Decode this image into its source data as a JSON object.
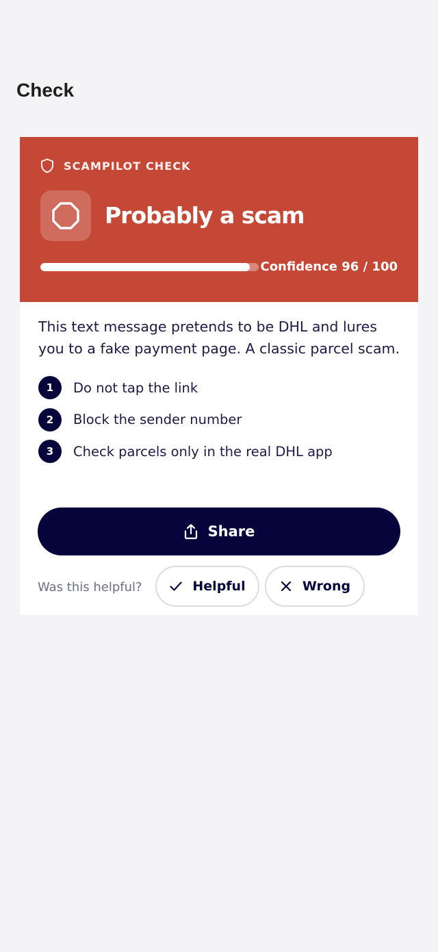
{
  "page": {
    "title": "Check"
  },
  "result_card": {
    "eyebrow": "SCAMPILOT CHECK",
    "eyebrow_icon": "shield-icon",
    "verdict_icon": "stop-octagon-icon",
    "verdict": "Probably a scam",
    "confidence_text": "Confidence 96 / 100",
    "confidence_value": 96,
    "confidence_max": 100,
    "summary": "This text message pretends to be DHL and lures you to a fake payment page. A classic parcel scam.",
    "steps": [
      {
        "number": "1",
        "text": "Do not tap the link"
      },
      {
        "number": "2",
        "text": "Block the sender number"
      },
      {
        "number": "3",
        "text": "Check parcels only in the real DHL app"
      }
    ],
    "share_label": "Share",
    "share_icon": "share-upload-icon",
    "feedback_prompt": "Was this helpful?",
    "helpful_label": "Helpful",
    "helpful_icon": "check-icon",
    "wrong_label": "Wrong",
    "wrong_icon": "close-icon"
  },
  "colors": {
    "page_background": "#f4f4f6",
    "header_red": "#c54836",
    "navy": "#06043b",
    "body_text": "#1b1a45",
    "muted_text": "#6c6f7f",
    "pill_border": "#dcdde2"
  }
}
